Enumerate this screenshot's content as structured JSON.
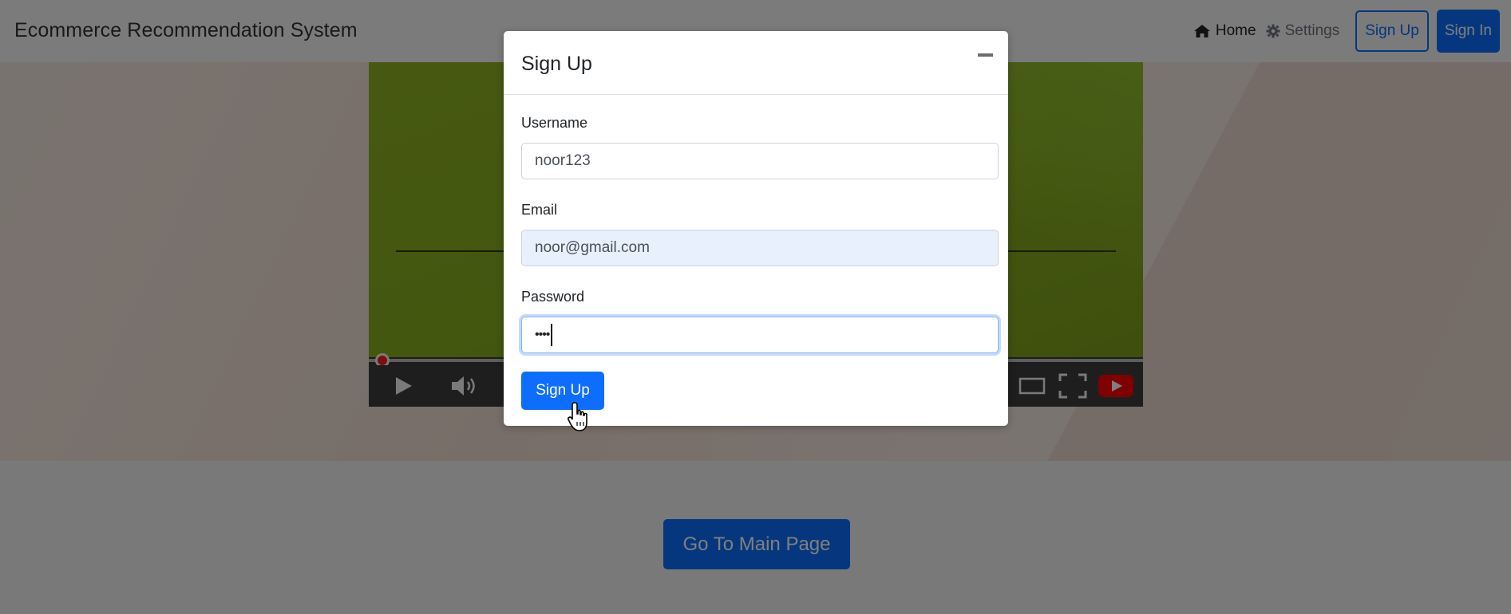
{
  "navbar": {
    "brand": "Ecommerce Recommendation System",
    "home_label": "Home",
    "settings_label": "Settings",
    "signup_label": "Sign Up",
    "signin_label": "Sign In"
  },
  "main": {
    "go_main_label": "Go To Main Page"
  },
  "modal": {
    "title": "Sign Up",
    "username_label": "Username",
    "username_value": "noor123",
    "email_label": "Email",
    "email_value": "noor@gmail.com",
    "password_label": "Password",
    "password_value": "••••",
    "submit_label": "Sign Up"
  },
  "colors": {
    "primary": "#0d6efd",
    "video_green": "#8fb321",
    "backdrop": "rgba(0,0,0,0.5)"
  },
  "icons": [
    "home-icon",
    "gear-icon",
    "minimize-icon",
    "play-icon",
    "volume-icon",
    "theater-mode-icon",
    "fullscreen-icon",
    "youtube-icon",
    "hand-cursor-icon"
  ]
}
